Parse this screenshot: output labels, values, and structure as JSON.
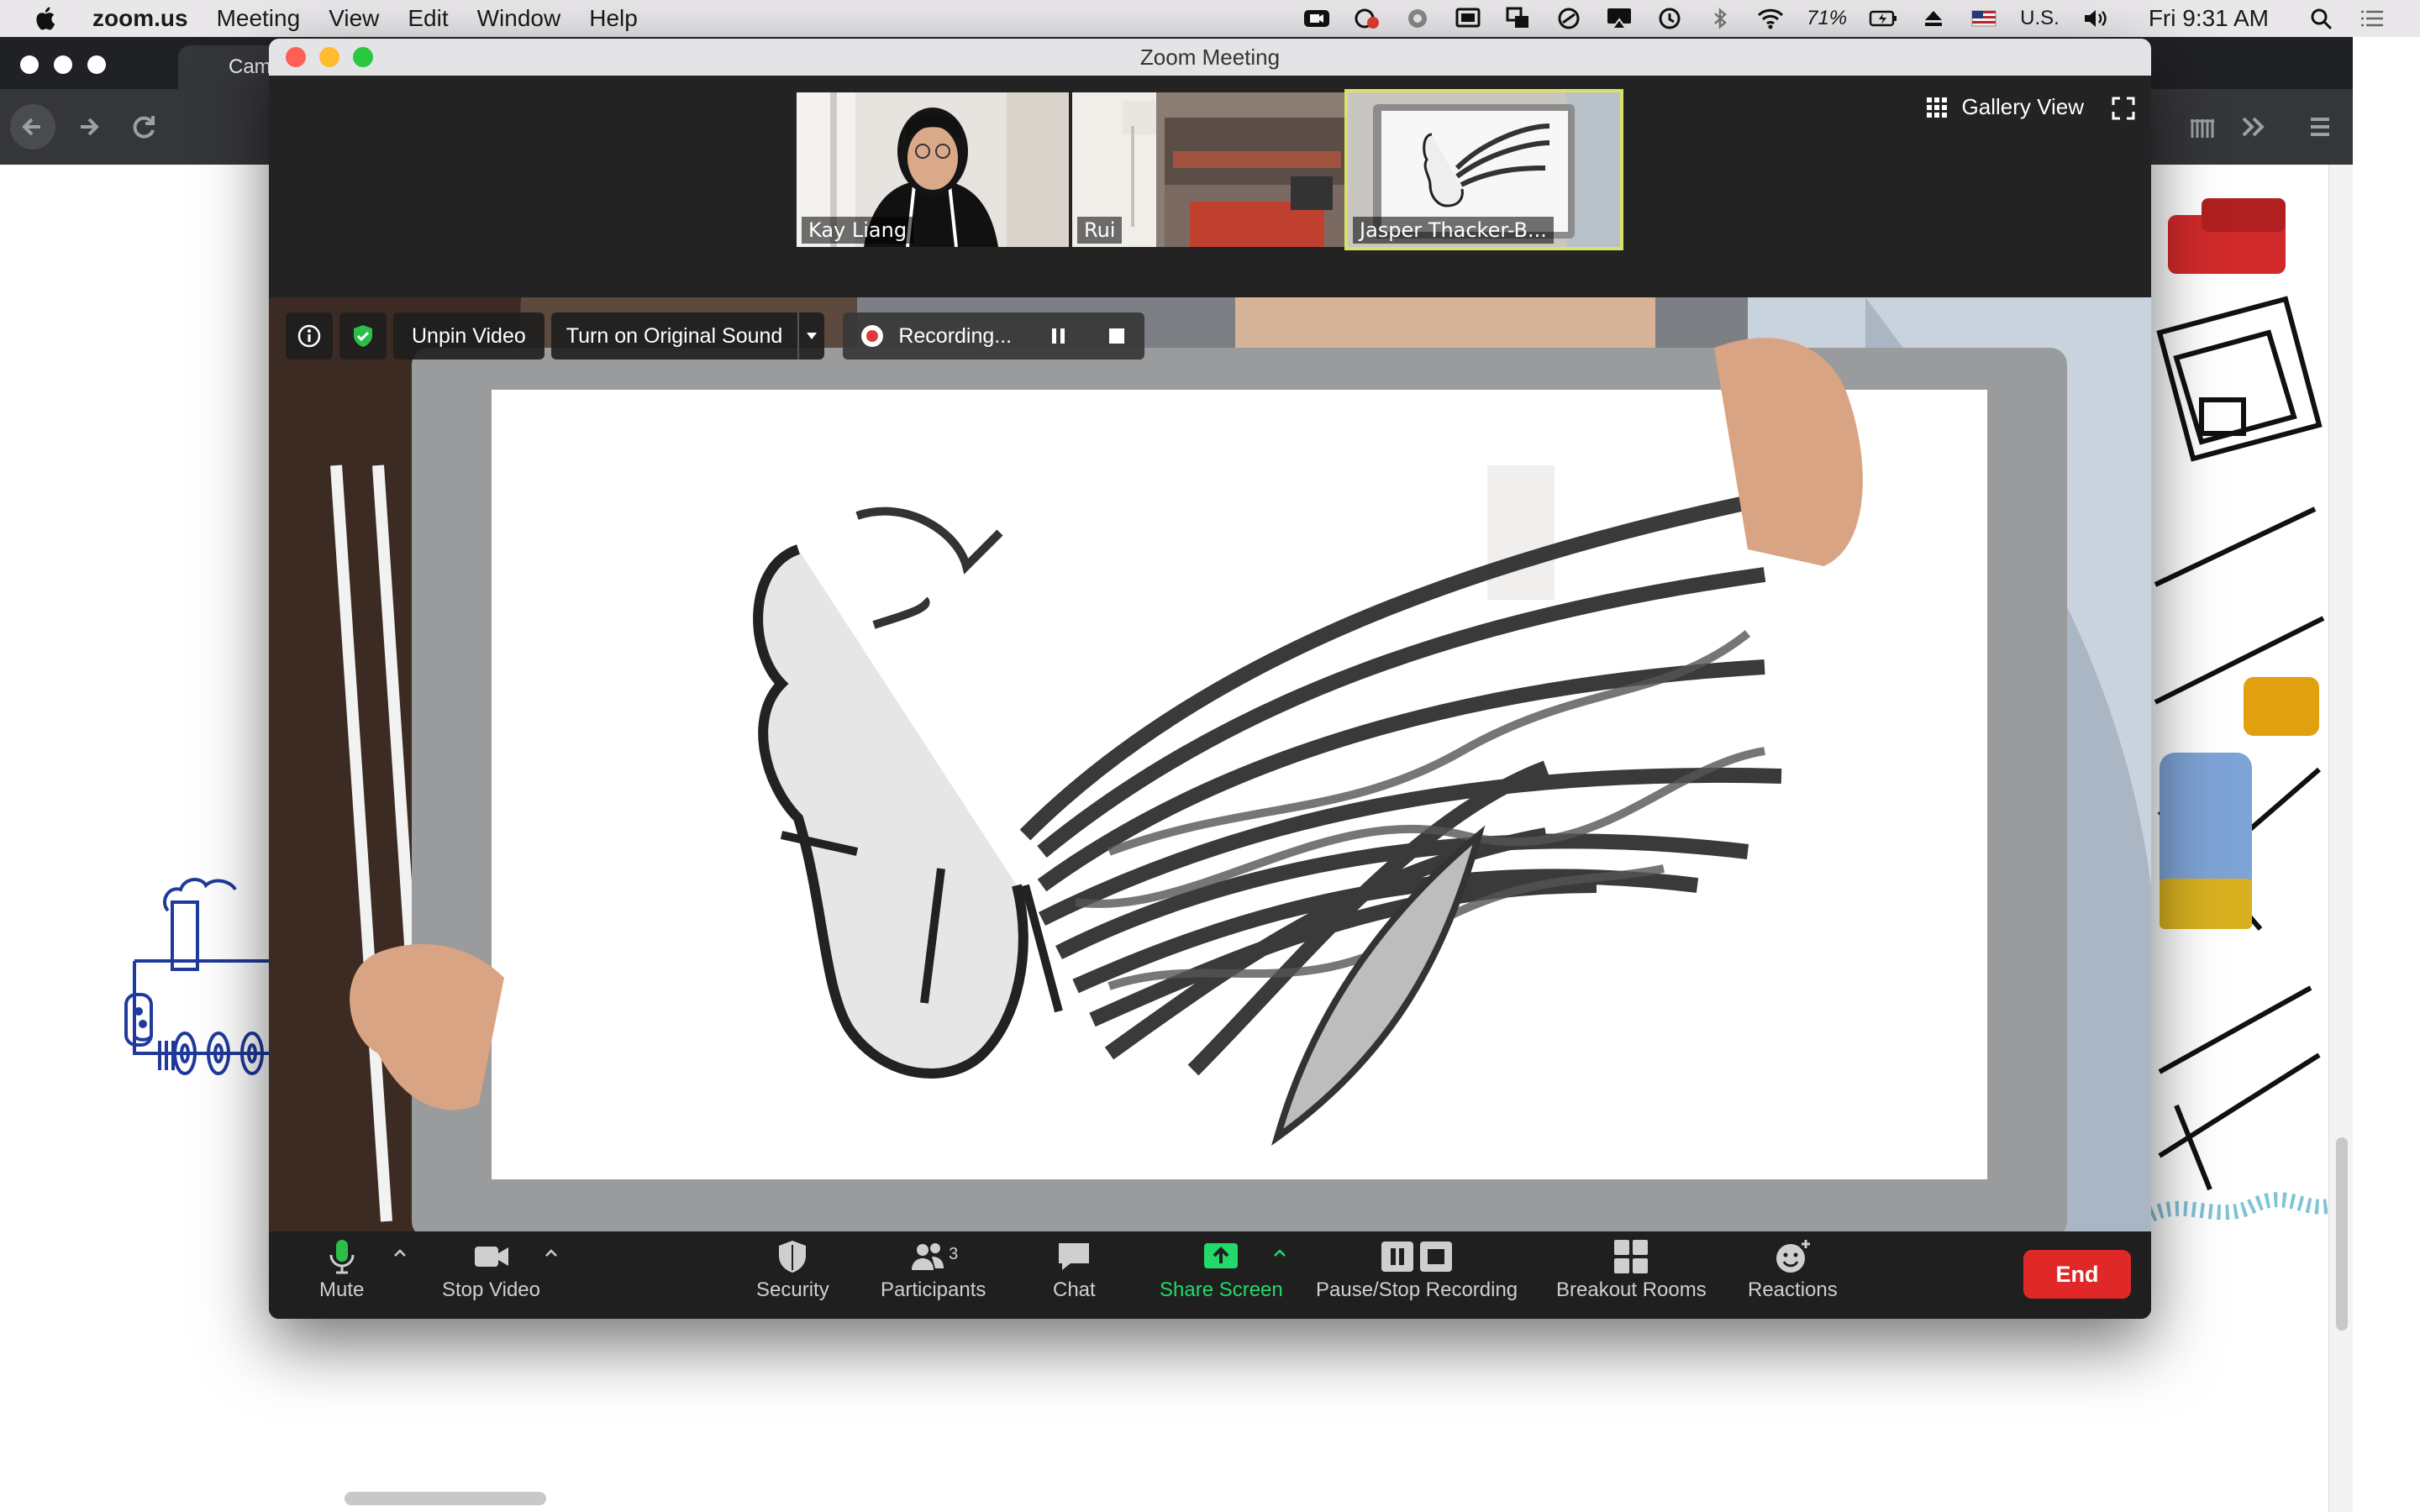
{
  "menubar": {
    "app": "zoom.us",
    "items": [
      "Meeting",
      "View",
      "Edit",
      "Window",
      "Help"
    ],
    "battery": "71%",
    "input_source": "U.S.",
    "clock": "Fri 9:31 AM"
  },
  "browser": {
    "tab_title": "Cam"
  },
  "zoom": {
    "window_title": "Zoom Meeting",
    "participants": [
      {
        "name": "Kay Liang"
      },
      {
        "name": "Rui"
      },
      {
        "name": "Jasper Thacker-B..."
      }
    ],
    "gallery_label": "Gallery View",
    "video_toolbar": {
      "unpin": "Unpin Video",
      "original_sound": "Turn on Original Sound",
      "recording": "Recording..."
    },
    "controls": {
      "mute": "Mute",
      "stop_video": "Stop Video",
      "security": "Security",
      "participants": "Participants",
      "participant_count": "3",
      "chat": "Chat",
      "share_screen": "Share Screen",
      "pause_stop_recording": "Pause/Stop Recording",
      "breakout_rooms": "Breakout Rooms",
      "reactions": "Reactions",
      "end": "End"
    },
    "colors": {
      "end": "#e02828",
      "share": "#23d96b",
      "active_speaker": "#d8e26a",
      "shield": "#2bbf4a"
    }
  }
}
